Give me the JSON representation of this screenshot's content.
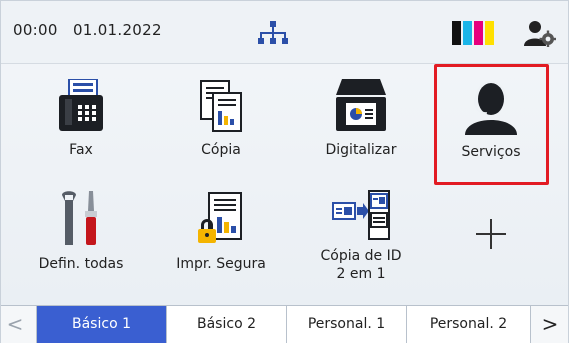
{
  "status": {
    "time": "00:00",
    "date": "01.01.2022",
    "icons": [
      "network-icon",
      "ink-level-icon",
      "account-settings-icon"
    ]
  },
  "tiles": [
    {
      "label": "Fax",
      "icon": "fax-icon"
    },
    {
      "label": "Cópia",
      "icon": "copy-icon"
    },
    {
      "label": "Digitalizar",
      "icon": "scanner-icon"
    },
    {
      "label": "Serviços",
      "icon": "services-headset-icon"
    },
    {
      "label": "Defin. todas",
      "icon": "tools-icon"
    },
    {
      "label": "Impr. Segura",
      "icon": "secure-print-icon"
    },
    {
      "label": "Cópia de ID\n2 em 1",
      "label_line1": "Cópia de ID",
      "label_line2": "2 em 1",
      "icon": "id-copy-icon"
    },
    {
      "label": "",
      "icon": "plus-icon"
    }
  ],
  "tabs": [
    {
      "label": "Básico 1",
      "active": true
    },
    {
      "label": "Básico 2",
      "active": false
    },
    {
      "label": "Personal. 1",
      "active": false
    },
    {
      "label": "Personal. 2",
      "active": false
    }
  ],
  "nav": {
    "left": "<",
    "right": ">"
  },
  "colors": {
    "highlight": "#e21b23",
    "active_tab": "#3a5fd1",
    "ink_black": "#111111",
    "ink_cyan": "#1bb5e8",
    "ink_magenta": "#e6007e",
    "ink_yellow": "#ffe000"
  }
}
